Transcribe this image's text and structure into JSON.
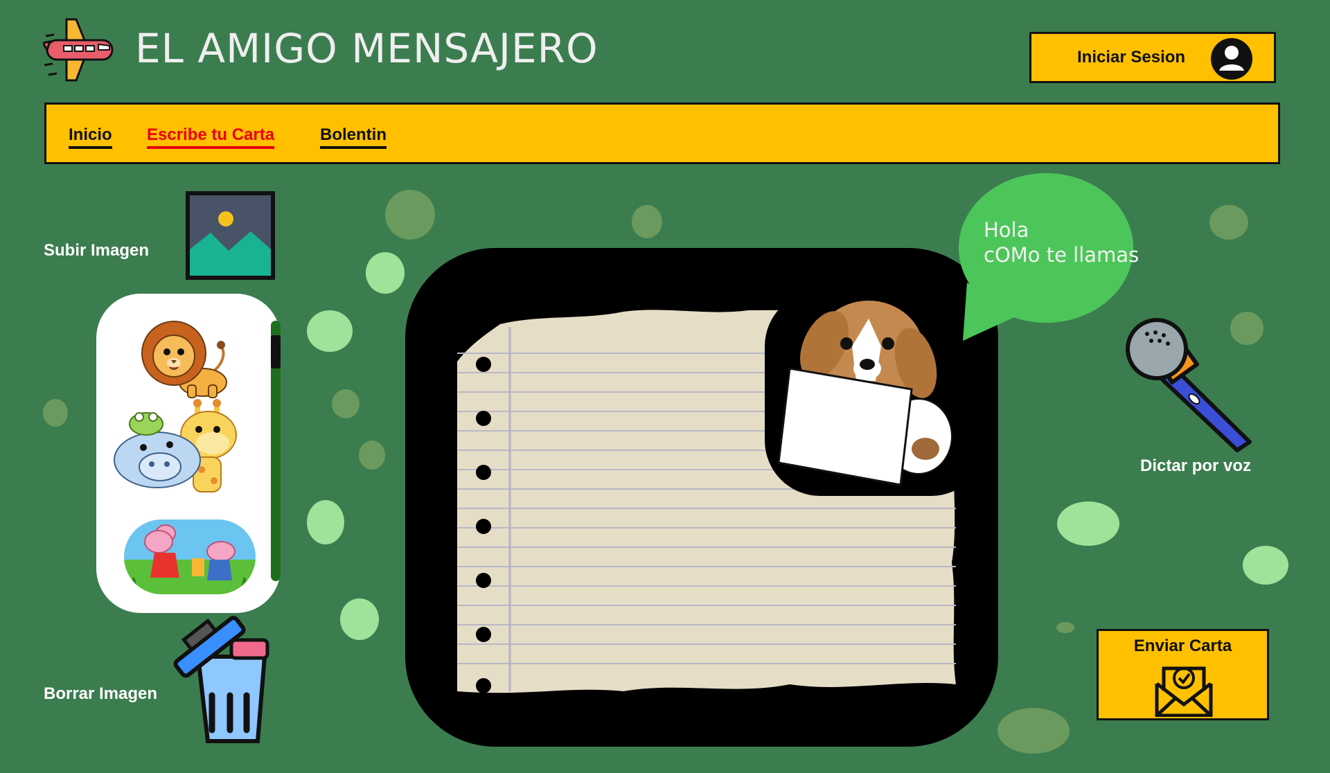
{
  "app": {
    "title": "EL AMIGO MENSAJERO",
    "logo_icon": "airplane-icon"
  },
  "header": {
    "login_label": "Iniciar Sesion",
    "user_icon": "user-avatar-icon"
  },
  "nav": {
    "items": [
      {
        "label": "Inicio",
        "active": false
      },
      {
        "label": "Escribe tu Carta",
        "active": true
      },
      {
        "label": "Bolentin",
        "active": false
      }
    ]
  },
  "sidebar": {
    "upload_label": "Subir Imagen",
    "delete_label": "Borrar Imagen",
    "gallery": [
      {
        "name": "lion-sticker"
      },
      {
        "name": "hippo-giraffe-sticker"
      },
      {
        "name": "peppa-pig-sticker"
      }
    ]
  },
  "letter": {
    "mascot": "dog-holding-letter",
    "speech": "Hola\ncOMo te llamas"
  },
  "actions": {
    "dictate_label": "Dictar por voz",
    "send_label": "Enviar Carta"
  },
  "colors": {
    "background": "#3c7d4f",
    "accent": "#ffc000",
    "active_link": "#e8000b",
    "speech_bubble": "#4cc65a"
  }
}
